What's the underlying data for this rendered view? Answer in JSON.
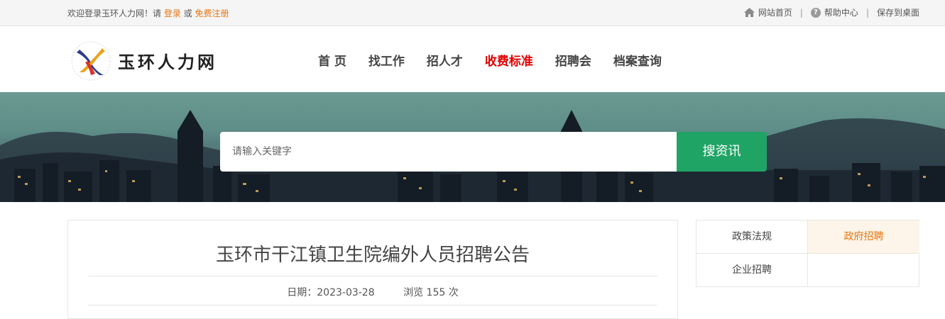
{
  "topbar": {
    "welcome": "欢迎登录玉环人力网！请",
    "login": "登录",
    "or": "或",
    "register": "免费注册",
    "home": "网站首页",
    "help": "帮助中心",
    "save": "保存到桌面",
    "separator": "|"
  },
  "header": {
    "site_name": "玉环人力网",
    "nav": [
      "首 页",
      "找工作",
      "招人才",
      "收费标准",
      "招聘会",
      "档案查询"
    ],
    "active_nav": "收费标准",
    "active_color": "#e00000"
  },
  "search": {
    "placeholder": "请输入关键字",
    "button": "搜资讯",
    "button_color": "#1fa466"
  },
  "article": {
    "title": "玉环市干江镇卫生院编外人员招聘公告",
    "date_label": "日期：2023-03-28",
    "views_label": "浏览 155 次"
  },
  "sidebar": {
    "items": [
      "政策法规",
      "政府招聘",
      "企业招聘",
      ""
    ],
    "active": "政府招聘",
    "accent": "#e8730f"
  },
  "icons": {
    "home": "home-icon",
    "help": "help-icon",
    "logo": "logo-icon"
  }
}
